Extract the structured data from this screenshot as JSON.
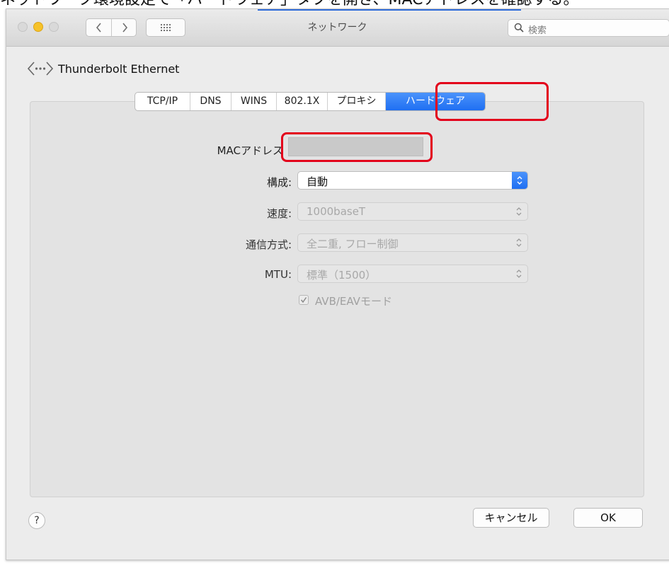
{
  "caption": "ネットワーク環境設定で「ハードウェア」タブを開き、MACアドレスを確認する。",
  "window": {
    "title": "ネットワーク",
    "search_placeholder": "検索"
  },
  "interface_name": "Thunderbolt Ethernet",
  "tabs": [
    {
      "label": "TCP/IP"
    },
    {
      "label": "DNS"
    },
    {
      "label": "WINS"
    },
    {
      "label": "802.1X"
    },
    {
      "label": "プロキシ"
    },
    {
      "label": "ハードウェア",
      "active": true
    }
  ],
  "form": {
    "mac": {
      "label": "MACアドレス",
      "value": ""
    },
    "config": {
      "label": "構成:",
      "value": "自動"
    },
    "speed": {
      "label": "速度:",
      "value": "1000baseT"
    },
    "duplex": {
      "label": "通信方式:",
      "value": "全二重, フロー制御"
    },
    "mtu": {
      "label": "MTU:",
      "value": "標準（1500）"
    },
    "avb": {
      "label": "AVB/EAVモード",
      "checked": true
    }
  },
  "buttons": {
    "help": "?",
    "cancel": "キャンセル",
    "ok": "OK"
  },
  "colors": {
    "highlight": "#e3001b",
    "accent": "#1f6ff2"
  }
}
